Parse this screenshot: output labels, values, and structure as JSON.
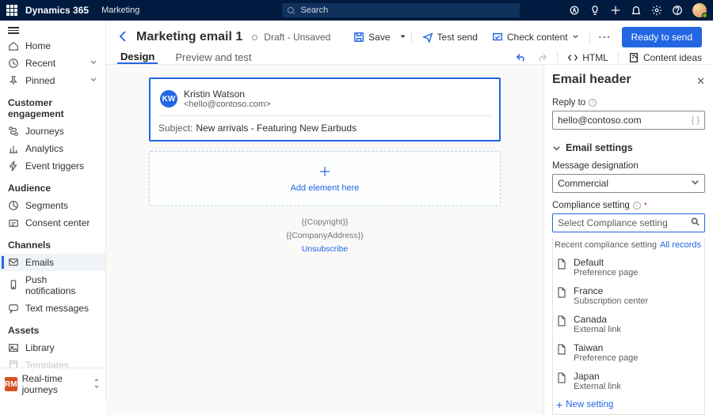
{
  "suite": {
    "product": "Dynamics 365",
    "area": "Marketing",
    "search_placeholder": "Search"
  },
  "nav": {
    "home": "Home",
    "recent": "Recent",
    "pinned": "Pinned",
    "sections": {
      "engagement": "Customer engagement",
      "audience": "Audience",
      "channels": "Channels",
      "assets": "Assets"
    },
    "items": {
      "journeys": "Journeys",
      "analytics": "Analytics",
      "triggers": "Event triggers",
      "segments": "Segments",
      "consent": "Consent center",
      "emails": "Emails",
      "push": "Push notifications",
      "text": "Text messages",
      "library": "Library",
      "templates": "Templates"
    },
    "area_switch": {
      "badge": "RM",
      "label": "Real-time journeys"
    }
  },
  "record": {
    "title": "Marketing email 1",
    "status": "Draft - Unsaved"
  },
  "commands": {
    "save": "Save",
    "test": "Test send",
    "check": "Check content",
    "primary": "Ready to send"
  },
  "tabs": {
    "design": "Design",
    "preview": "Preview and test",
    "html": "HTML",
    "ideas": "Content ideas"
  },
  "email": {
    "avatar": "KW",
    "from_name": "Kristin Watson",
    "from_addr": "<hello@contoso.com>",
    "subject_label": "Subject:",
    "subject": "New arrivals - Featuring New Earbuds",
    "drop_hint": "Add element here",
    "footer1": "{{Copyright}}",
    "footer2": "{{CompanyAddress}}",
    "unsubscribe": "Unsubscribe"
  },
  "side": {
    "title": "Email header",
    "reply_to_label": "Reply to",
    "reply_to_value": "hello@contoso.com",
    "settings_head": "Email settings",
    "designation_label": "Message designation",
    "designation_value": "Commercial",
    "compliance_label": "Compliance setting",
    "compliance_placeholder": "Select Compliance setting",
    "recent_label": "Recent compliance setting",
    "all_records": "All records",
    "options": [
      {
        "t1": "Default",
        "t2": "Preference page"
      },
      {
        "t1": "France",
        "t2": "Subscription center"
      },
      {
        "t1": "Canada",
        "t2": "External link"
      },
      {
        "t1": "Taiwan",
        "t2": "Preference page"
      },
      {
        "t1": "Japan",
        "t2": "External link"
      }
    ],
    "new_setting": "New setting"
  }
}
